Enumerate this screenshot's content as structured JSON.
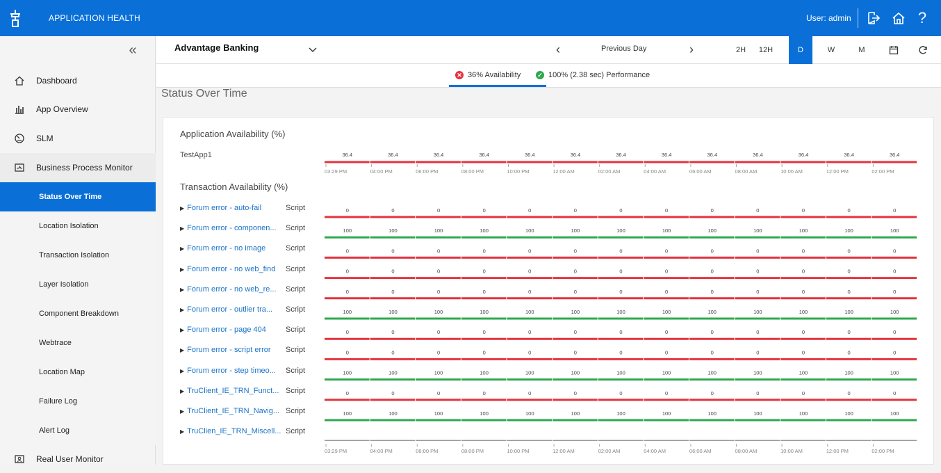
{
  "header": {
    "app_title": "APPLICATION HEALTH",
    "user_label": "User: admin",
    "icons": [
      "logo-icon",
      "logout-icon",
      "home-icon",
      "help-icon"
    ]
  },
  "sidebar": {
    "collapse_glyph": "«",
    "items": [
      {
        "label": "Dashboard",
        "icon": "home-icon"
      },
      {
        "label": "App Overview",
        "icon": "bar-chart-icon"
      },
      {
        "label": "SLM",
        "icon": "gauge-icon"
      },
      {
        "label": "Business Process Monitor",
        "icon": "monitor-icon"
      },
      {
        "label": "Real User Monitor",
        "icon": "user-monitor-icon"
      }
    ],
    "sub_items": [
      {
        "label": "Status Over Time",
        "active": true
      },
      {
        "label": "Location Isolation",
        "active": false
      },
      {
        "label": "Transaction Isolation",
        "active": false
      },
      {
        "label": "Layer Isolation",
        "active": false
      },
      {
        "label": "Component Breakdown",
        "active": false
      },
      {
        "label": "Webtrace",
        "active": false
      },
      {
        "label": "Location Map",
        "active": false
      },
      {
        "label": "Failure Log",
        "active": false
      },
      {
        "label": "Alert Log",
        "active": false
      }
    ]
  },
  "toolbar": {
    "app_name": "Advantage Banking",
    "prev_arrow": "‹",
    "next_arrow": "›",
    "prev_day_label": "Previous Day",
    "ranges": [
      "2H",
      "12H",
      "D",
      "W",
      "M"
    ],
    "active_range": "D",
    "icons": [
      "calendar-icon",
      "refresh-icon"
    ]
  },
  "status": {
    "availability_label": "36% Availability",
    "performance_label": "100% (2.38 sec) Performance",
    "colors": {
      "fail": "#e5323e",
      "ok": "#2ea84f",
      "accent": "#0a70d8"
    }
  },
  "page_title": "Status Over Time",
  "chart": {
    "app_section_title": "Application Availability (%)",
    "txn_section_title": "Transaction Availability (%)",
    "time_labels": [
      "03:29 PM",
      "04:00 PM",
      "06:00 PM",
      "08:00 PM",
      "10:00 PM",
      "12:00 AM",
      "02:00 AM",
      "04:00 AM",
      "06:00 AM",
      "08:00 AM",
      "10:00 AM",
      "12:00 PM",
      "02:00 PM"
    ],
    "app_rows": [
      {
        "name": "TestApp1",
        "values": [
          "36.4",
          "36.4",
          "36.4",
          "36.4",
          "36.4",
          "36.4",
          "36.4",
          "36.4",
          "36.4",
          "36.4",
          "36.4",
          "36.4",
          "36.4"
        ],
        "status": "fail"
      }
    ],
    "txn_rows": [
      {
        "name": "Forum error - auto-fail",
        "type": "Script",
        "value": "0",
        "status": "fail"
      },
      {
        "name": "Forum error - componen...",
        "type": "Script",
        "value": "100",
        "status": "ok"
      },
      {
        "name": "Forum error - no image",
        "type": "Script",
        "value": "0",
        "status": "fail"
      },
      {
        "name": "Forum error - no web_find",
        "type": "Script",
        "value": "0",
        "status": "fail"
      },
      {
        "name": "Forum error - no web_re...",
        "type": "Script",
        "value": "0",
        "status": "fail"
      },
      {
        "name": "Forum error - outlier tra...",
        "type": "Script",
        "value": "100",
        "status": "ok"
      },
      {
        "name": "Forum error - page 404",
        "type": "Script",
        "value": "0",
        "status": "fail"
      },
      {
        "name": "Forum error - script error",
        "type": "Script",
        "value": "0",
        "status": "fail"
      },
      {
        "name": "Forum error - step timeo...",
        "type": "Script",
        "value": "100",
        "status": "ok"
      },
      {
        "name": "TruClient_IE_TRN_Funct...",
        "type": "Script",
        "value": "0",
        "status": "fail"
      },
      {
        "name": "TruClient_IE_TRN_Navig...",
        "type": "Script",
        "value": "100",
        "status": "ok"
      },
      {
        "name": "TruClien_IE_TRN_Miscell...",
        "type": "Script",
        "value": "",
        "status": "none"
      }
    ]
  }
}
